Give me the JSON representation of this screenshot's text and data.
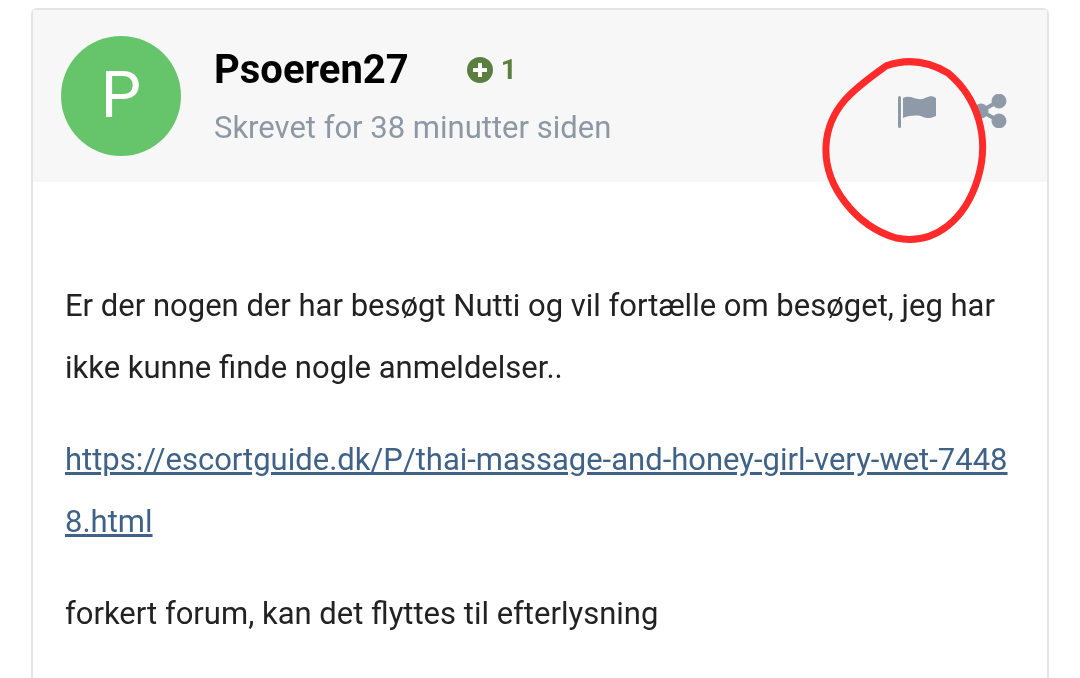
{
  "post": {
    "avatar_letter": "P",
    "author": "Psoeren27",
    "reputation": "1",
    "posted": "Skrevet for 38 minutter siden",
    "paragraphs": [
      {
        "kind": "text",
        "text": "Er der nogen der har besøgt Nutti og vil fortælle om besøget, jeg har ikke kunne finde nogle anmeldelser.."
      },
      {
        "kind": "link",
        "text": "https://escortguide.dk/P/thai-massage-and-honey-girl-very-wet-74488.html"
      },
      {
        "kind": "text",
        "text": "forkert forum, kan det flyttes til efterlysning"
      }
    ]
  }
}
